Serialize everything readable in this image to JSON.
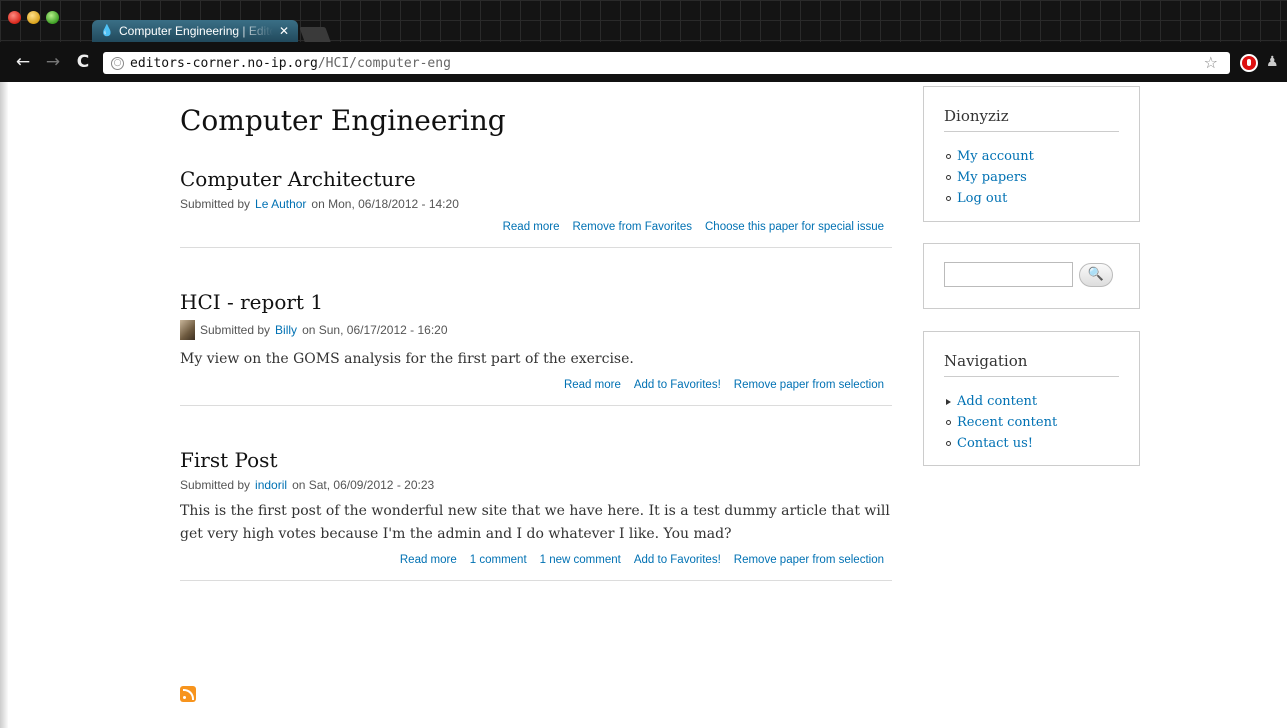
{
  "browser": {
    "tab_title": "Computer Engineering | Editors Corner",
    "url_domain": "editors-corner.no-ip.org",
    "url_path": "/HCI/computer-eng",
    "close_glyph": "✕",
    "back_glyph": "←",
    "forward_glyph": "→",
    "reload_glyph": "C",
    "star_glyph": "☆",
    "globe_glyph": "○"
  },
  "page": {
    "title": "Computer Engineering"
  },
  "nodes": [
    {
      "title": "Computer Architecture",
      "submitted_prefix": "Submitted by",
      "author": "Le Author",
      "date": "on Mon, 06/18/2012 - 14:20",
      "teaser": "",
      "links": [
        "Read more",
        "Remove from Favorites",
        "Choose this paper for special issue"
      ]
    },
    {
      "title": "HCI - report 1",
      "submitted_prefix": "Submitted by",
      "author": "Billy",
      "date": "on Sun, 06/17/2012 - 16:20",
      "teaser": "My view on the GOMS analysis for the first part of the exercise.",
      "links": [
        "Read more",
        "Add to Favorites!",
        "Remove paper from selection"
      ]
    },
    {
      "title": "First Post",
      "submitted_prefix": "Submitted by",
      "author": "indoril",
      "date": "on Sat, 06/09/2012 - 20:23",
      "teaser": "This is the first post of the wonderful new site that we have here. It is a test dummy article that will get very high votes because I'm the admin and I do whatever I like. You mad?",
      "links": [
        "Read more",
        "1 comment",
        "1 new comment",
        "Add to Favorites!",
        "Remove paper from selection"
      ]
    }
  ],
  "sidebar": {
    "user_block": {
      "title": "Dionyziz",
      "items": [
        "My account",
        "My papers",
        "Log out"
      ]
    },
    "search_block": {
      "button_glyph": "🔍"
    },
    "nav_block": {
      "title": "Navigation",
      "items": [
        "Add content",
        "Recent content",
        "Contact us!"
      ]
    }
  },
  "colors": {
    "link": "#0071b3",
    "rss": "#f7941d"
  }
}
